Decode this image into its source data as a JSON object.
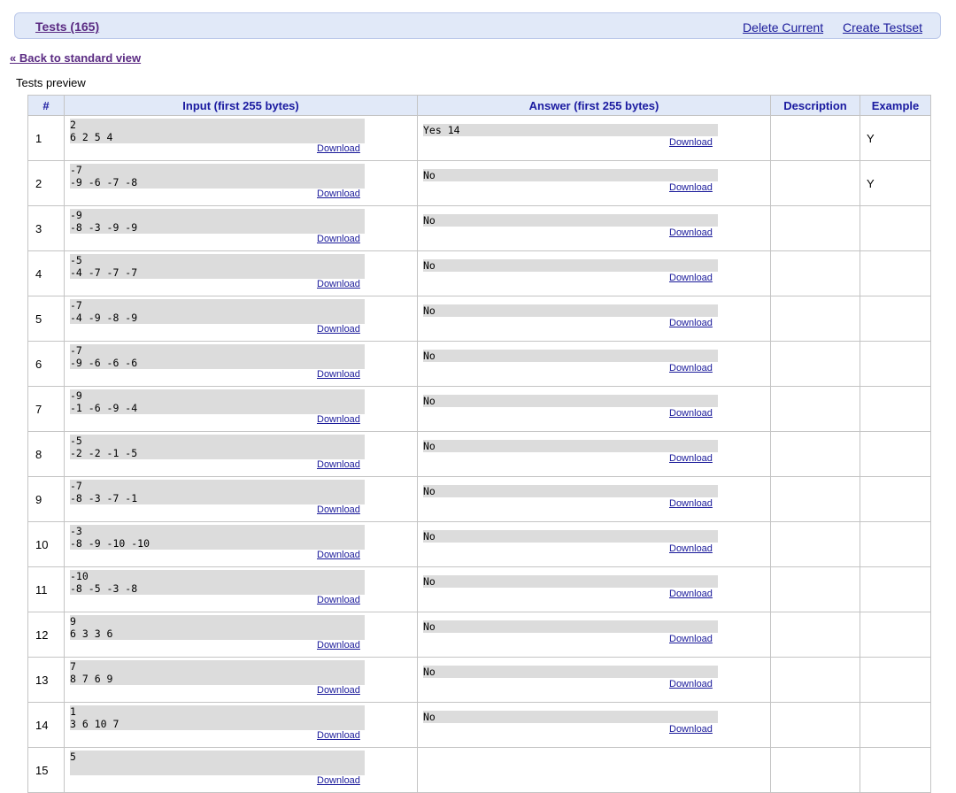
{
  "header": {
    "tests_link": "Tests (165)",
    "delete_current": "Delete Current",
    "create_testset": "Create Testset"
  },
  "back_link": "« Back to standard view",
  "preview_title": "Tests preview",
  "table": {
    "columns": [
      "#",
      "Input (first 255 bytes)",
      "Answer (first 255 bytes)",
      "Description",
      "Example"
    ],
    "download_label": "Download",
    "rows": [
      {
        "num": "1",
        "input": "2\n6 2 5 4",
        "answer": "Yes 14",
        "description": "",
        "example": "Y"
      },
      {
        "num": "2",
        "input": "-7\n-9 -6 -7 -8",
        "answer": "No",
        "description": "",
        "example": "Y"
      },
      {
        "num": "3",
        "input": "-9\n-8 -3 -9 -9",
        "answer": "No",
        "description": "",
        "example": ""
      },
      {
        "num": "4",
        "input": "-5\n-4 -7 -7 -7",
        "answer": "No",
        "description": "",
        "example": ""
      },
      {
        "num": "5",
        "input": "-7\n-4 -9 -8 -9",
        "answer": "No",
        "description": "",
        "example": ""
      },
      {
        "num": "6",
        "input": "-7\n-9 -6 -6 -6",
        "answer": "No",
        "description": "",
        "example": ""
      },
      {
        "num": "7",
        "input": "-9\n-1 -6 -9 -4",
        "answer": "No",
        "description": "",
        "example": ""
      },
      {
        "num": "8",
        "input": "-5\n-2 -2 -1 -5",
        "answer": "No",
        "description": "",
        "example": ""
      },
      {
        "num": "9",
        "input": "-7\n-8 -3 -7 -1",
        "answer": "No",
        "description": "",
        "example": ""
      },
      {
        "num": "10",
        "input": "-3\n-8 -9 -10 -10",
        "answer": "No",
        "description": "",
        "example": ""
      },
      {
        "num": "11",
        "input": "-10\n-8 -5 -3 -8",
        "answer": "No",
        "description": "",
        "example": ""
      },
      {
        "num": "12",
        "input": "9\n6 3 3 6",
        "answer": "No",
        "description": "",
        "example": ""
      },
      {
        "num": "13",
        "input": "7\n8 7 6 9",
        "answer": "No",
        "description": "",
        "example": ""
      },
      {
        "num": "14",
        "input": "1\n3 6 10 7",
        "answer": "No",
        "description": "",
        "example": ""
      },
      {
        "num": "15",
        "input": "5",
        "answer": "",
        "description": "",
        "example": ""
      }
    ]
  }
}
